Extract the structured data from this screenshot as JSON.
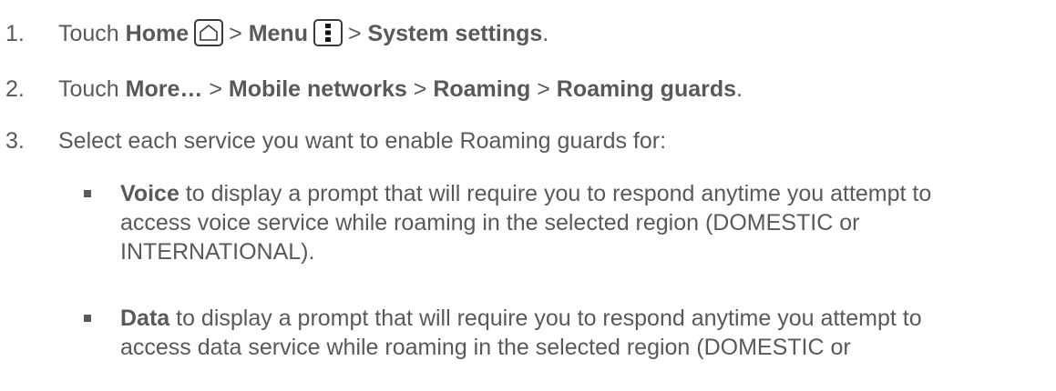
{
  "steps": [
    {
      "num": "1.",
      "touch": "Touch",
      "home": "Home",
      "sep1": ">",
      "menu": "Menu",
      "sep2": ">",
      "system_settings": "System settings",
      "end": ".",
      "home_icon": "home-icon",
      "menu_icon": "menu-icon"
    },
    {
      "num": "2.",
      "touch": "Touch",
      "more": "More…",
      "sep1": ">",
      "mobile_networks": "Mobile networks",
      "sep2": ">",
      "roaming": "Roaming",
      "sep3": ">",
      "roaming_guards": "Roaming guards",
      "end": "."
    },
    {
      "num": "3.",
      "text": "Select each service you want to enable Roaming guards for:"
    }
  ],
  "sub_items": [
    {
      "term": "Voice",
      "line1": " to display a prompt that will require you to respond anytime you attempt to",
      "line2": "access voice service while roaming in the selected region (DOMESTIC or",
      "line3": "INTERNATIONAL)."
    },
    {
      "term": "Data",
      "line1": " to display a prompt that will require you to respond anytime you attempt to",
      "line2": "access data service while roaming in the selected region (DOMESTIC or"
    }
  ]
}
